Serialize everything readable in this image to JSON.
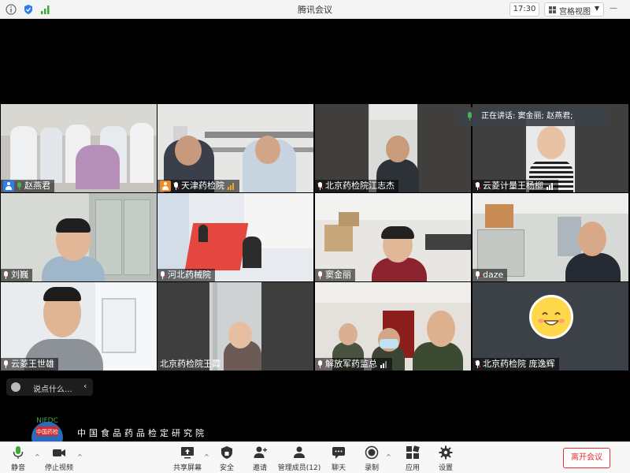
{
  "titlebar": {
    "title": "腾讯会议",
    "time": "17:30",
    "view_label": "宫格视图"
  },
  "speaking": {
    "text": "正在讲话: 窦金丽; 赵燕君;"
  },
  "tiles": [
    {
      "name": "赵燕君"
    },
    {
      "name": "天津药检院"
    },
    {
      "name": "北京药检院江志杰"
    },
    {
      "name": "云菱计量王杨柳"
    },
    {
      "name": "刘巍"
    },
    {
      "name": "河北药械院"
    },
    {
      "name": "窦金丽"
    },
    {
      "name": "daze"
    },
    {
      "name": "云菱王世雄"
    },
    {
      "name": "北京药检院王霞"
    },
    {
      "name": "解放军药监总"
    },
    {
      "name": "北京药检院 庞逸辉"
    }
  ],
  "chat": {
    "placeholder": "说点什么..."
  },
  "branding": {
    "logo_text": "NIFDC",
    "logo_subtext": "中国药检",
    "org_name": "中国食品药品检定研究院"
  },
  "toolbar": {
    "mute": "静音",
    "stop_video": "停止视频",
    "share_screen": "共享屏幕",
    "security": "安全",
    "invite": "邀请",
    "manage_members": "管理成员(12)",
    "chat": "聊天",
    "record": "录制",
    "apps": "应用",
    "settings": "设置",
    "leave": "离开会议"
  },
  "colors": {
    "accent_blue": "#2b7cf6",
    "leave_red": "#e0302f",
    "speaking_green": "#4caf50"
  }
}
